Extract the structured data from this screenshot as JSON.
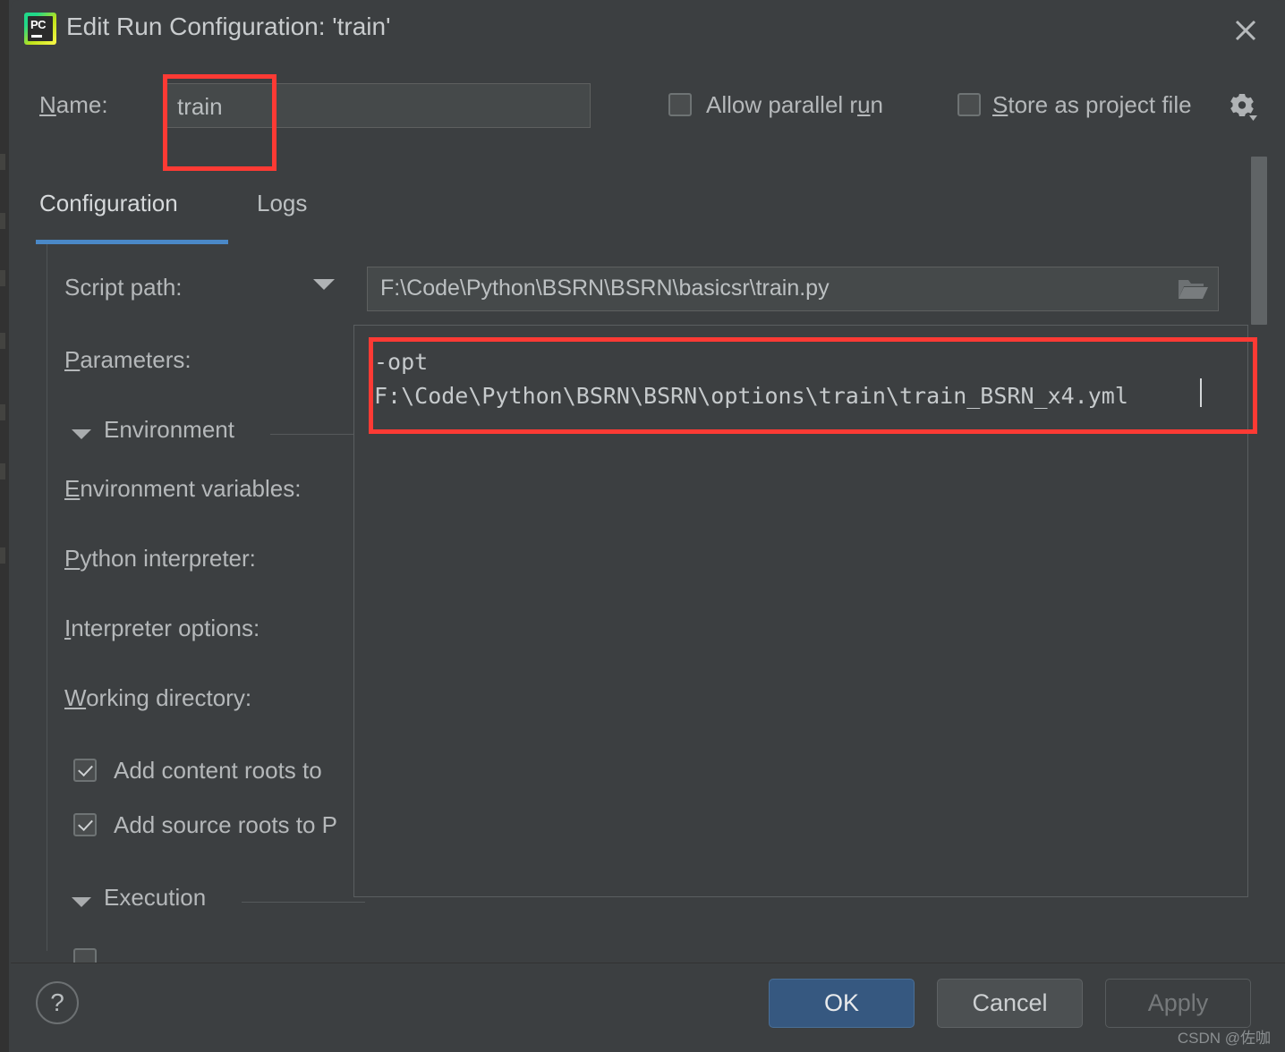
{
  "window": {
    "title": "Edit Run Configuration: 'train'",
    "app_icon": "pycharm-icon",
    "app_icon_text": "PC",
    "close_icon": "close-icon"
  },
  "name_row": {
    "label_prefix": "N",
    "label_rest": "ame:",
    "value": "train",
    "allow_parallel": {
      "label_pre": "Allow parallel r",
      "label_mn": "u",
      "label_post": "n",
      "checked": false
    },
    "store_as_project_file": {
      "label_mn": "S",
      "label_post": "tore as project file",
      "checked": false
    },
    "gear_icon": "gear-icon"
  },
  "tabs": [
    {
      "label": "Configuration",
      "active": true
    },
    {
      "label": "Logs",
      "active": false
    }
  ],
  "form": {
    "script_path": {
      "label": "Script path:",
      "value": "F:\\Code\\Python\\BSRN\\BSRN\\basicsr\\train.py",
      "browse_icon": "folder-icon",
      "dropdown_icon": "chevron-down-icon"
    },
    "parameters": {
      "label_mn": "P",
      "label_post": "arameters:",
      "value_line1": "-opt",
      "value_line2": "F:\\Code\\Python\\BSRN\\BSRN\\options\\train\\train_BSRN_x4.yml"
    },
    "sections": [
      {
        "title": "Environment",
        "expanded": true
      },
      {
        "title": "Execution",
        "expanded": true
      }
    ],
    "fields": [
      {
        "mn": "E",
        "rest": "nvironment variables:"
      },
      {
        "mn": "P",
        "rest": "ython interpreter:"
      },
      {
        "mn": "I",
        "rest": "nterpreter options:"
      },
      {
        "mn": "W",
        "rest": "orking directory:"
      }
    ],
    "checkboxes": [
      {
        "label": "Add content roots to",
        "checked": true
      },
      {
        "label": "Add source roots to P",
        "checked": true
      }
    ]
  },
  "footer": {
    "help_label": "?",
    "ok_label": "OK",
    "cancel_label": "Cancel",
    "apply_label": "Apply"
  },
  "watermark": "CSDN @佐咖",
  "colors": {
    "accent": "#4a88c7",
    "annotation": "#fd3a34",
    "ok_button": "#365880",
    "dialog_bg": "#3c3f41"
  }
}
